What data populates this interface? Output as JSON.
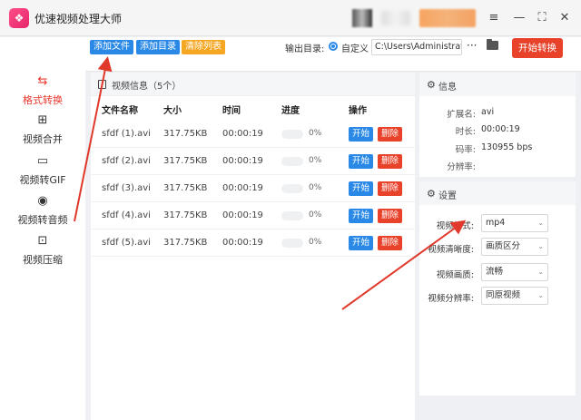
{
  "app": {
    "logo_glyph": "❖",
    "title": "优速视频处理大师"
  },
  "window": {
    "menu_glyph": "≡",
    "minimize_glyph": "—",
    "maximize_glyph": "⛶",
    "close_glyph": "✕"
  },
  "sidebar": {
    "items": [
      {
        "label": "格式转换",
        "icon": "convert-icon",
        "glyph": "⇆",
        "active": true
      },
      {
        "label": "视频合并",
        "icon": "merge-icon",
        "glyph": "⊞",
        "active": false
      },
      {
        "label": "视频转GIF",
        "icon": "gif-icon",
        "glyph": "▭",
        "active": false
      },
      {
        "label": "视频转音频",
        "icon": "audio-icon",
        "glyph": "◉",
        "active": false
      },
      {
        "label": "视频压缩",
        "icon": "compress-icon",
        "glyph": "⊡",
        "active": false
      }
    ]
  },
  "toolbar": {
    "add_file": "添加文件",
    "add_folder": "添加目录",
    "clear_list": "清除列表",
    "output_label": "输出目录:",
    "custom_label": "自定义",
    "output_path": "C:\\Users\\Administrator\\",
    "more": "···",
    "start_all": "开始转换"
  },
  "file_panel": {
    "title": "视频信息（5个）",
    "columns": [
      "文件名称",
      "大小",
      "时间",
      "进度",
      "操作"
    ],
    "rows": [
      {
        "name": "sfdf (1).avi",
        "size": "317.75KB",
        "time": "00:00:19",
        "progress": "0%",
        "start": "开始",
        "delete": "删除"
      },
      {
        "name": "sfdf (2).avi",
        "size": "317.75KB",
        "time": "00:00:19",
        "progress": "0%",
        "start": "开始",
        "delete": "删除"
      },
      {
        "name": "sfdf (3).avi",
        "size": "317.75KB",
        "time": "00:00:19",
        "progress": "0%",
        "start": "开始",
        "delete": "删除"
      },
      {
        "name": "sfdf (4).avi",
        "size": "317.75KB",
        "time": "00:00:19",
        "progress": "0%",
        "start": "开始",
        "delete": "删除"
      },
      {
        "name": "sfdf (5).avi",
        "size": "317.75KB",
        "time": "00:00:19",
        "progress": "0%",
        "start": "开始",
        "delete": "删除"
      }
    ]
  },
  "info_panel": {
    "title": "信息",
    "fields": [
      {
        "key": "扩展名:",
        "value": "avi"
      },
      {
        "key": "时长:",
        "value": "00:00:19"
      },
      {
        "key": "码率:",
        "value": "130955 bps"
      },
      {
        "key": "分辨率:",
        "value": ""
      }
    ]
  },
  "settings_panel": {
    "title": "设置",
    "fields": [
      {
        "key": "视频格式:",
        "value": "mp4"
      },
      {
        "key": "视频清晰度:",
        "value": "画质区分"
      },
      {
        "key": "视频画质:",
        "value": "流畅"
      },
      {
        "key": "视频分辨率:",
        "value": "同原视频"
      }
    ]
  },
  "colors": {
    "accent_blue": "#2a89e6",
    "accent_red": "#e8422b",
    "accent_orange": "#f5a623",
    "annotation_arrow": "#e0392b"
  }
}
